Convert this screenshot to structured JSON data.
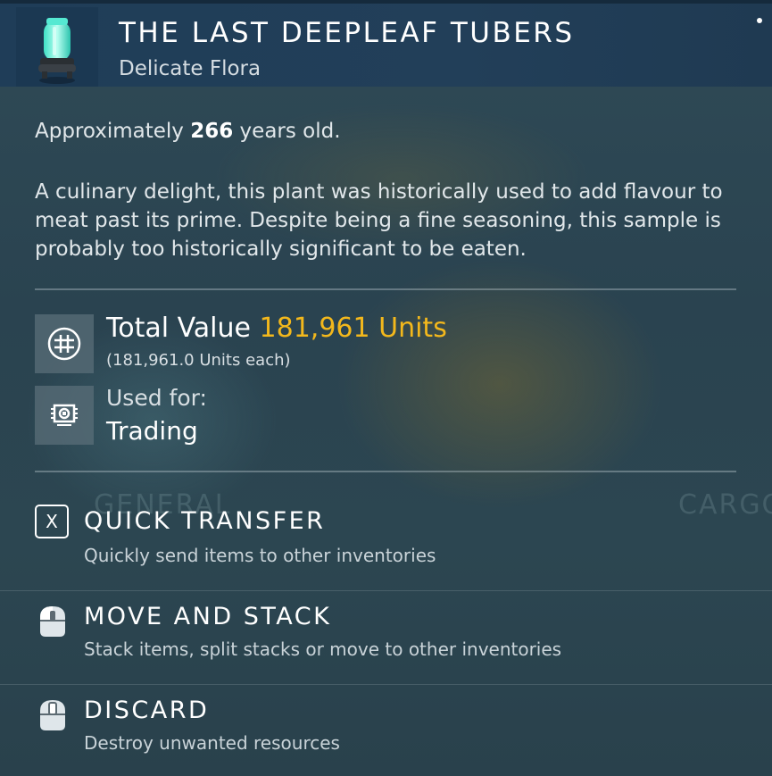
{
  "background": {
    "ghost_left": "GENERAL",
    "ghost_right": "CARGO"
  },
  "header": {
    "title": "THE LAST DEEPLEAF TUBERS",
    "subtitle": "Delicate Flora",
    "icon": "glowing-capsule-icon"
  },
  "details": {
    "age_prefix": "Approximately ",
    "age_value": "266",
    "age_suffix": " years old.",
    "description": "A culinary delight, this plant was historically used to add flavour to meat past its prime. Despite being a fine seasoning, this sample is probably too historically significant to be eaten."
  },
  "value": {
    "label": "Total Value ",
    "amount": "181,961 Units",
    "each": "(181,961.0 Units each)",
    "icon": "units-currency-icon",
    "color": "#f3b81c"
  },
  "usage": {
    "label": "Used for:",
    "value": "Trading",
    "icon": "trading-chip-icon"
  },
  "actions": [
    {
      "key": "X",
      "title": "QUICK TRANSFER",
      "desc": "Quickly send items to other inventories",
      "icon": "x-key-icon"
    },
    {
      "title": "MOVE AND STACK",
      "desc": "Stack items, split stacks or move to other inventories",
      "icon": "mouse-left-click-icon"
    },
    {
      "title": "DISCARD",
      "desc": "Destroy unwanted resources",
      "icon": "mouse-middle-click-icon"
    }
  ]
}
